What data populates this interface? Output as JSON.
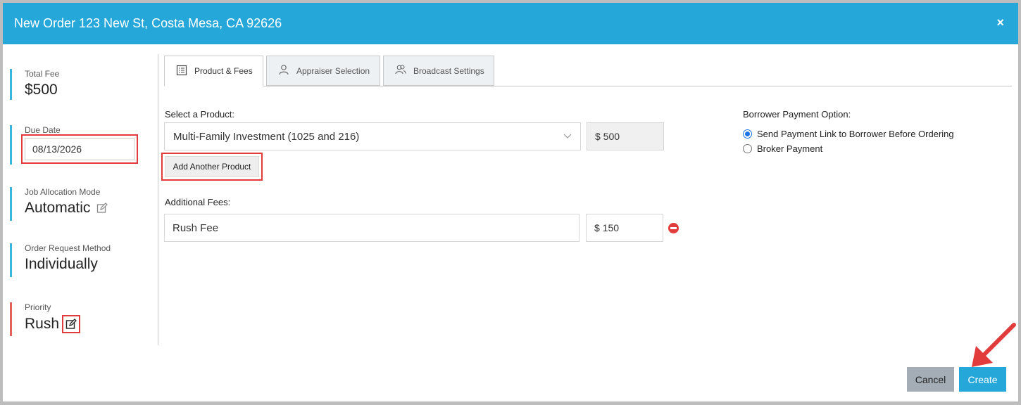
{
  "header": {
    "title": "New Order 123 New St, Costa Mesa, CA 92626",
    "close": "×"
  },
  "sidebar": {
    "total_fee": {
      "label": "Total Fee",
      "value": "$500"
    },
    "due_date": {
      "label": "Due Date",
      "value": "08/13/2026"
    },
    "job_allocation": {
      "label": "Job Allocation Mode",
      "value": "Automatic"
    },
    "order_request": {
      "label": "Order Request Method",
      "value": "Individually"
    },
    "priority": {
      "label": "Priority",
      "value": "Rush"
    }
  },
  "tabs": [
    {
      "label": "Product & Fees",
      "icon": "list-icon",
      "active": true
    },
    {
      "label": "Appraiser Selection",
      "icon": "person-icon",
      "active": false
    },
    {
      "label": "Broadcast Settings",
      "icon": "people-icon",
      "active": false
    }
  ],
  "product": {
    "label": "Select a Product:",
    "selected": "Multi-Family Investment (1025 and 216)",
    "price": "$ 500",
    "add_button": "Add Another Product"
  },
  "fees": {
    "label": "Additional Fees:",
    "name": "Rush Fee",
    "amount": "$ 150"
  },
  "payment": {
    "label": "Borrower Payment Option:",
    "options": [
      {
        "label": "Send Payment Link to Borrower Before Ordering",
        "checked": true
      },
      {
        "label": "Broker Payment",
        "checked": false
      }
    ]
  },
  "footer": {
    "cancel": "Cancel",
    "create": "Create"
  },
  "colors": {
    "header": "#26a7d9",
    "highlight": "#e23b3b",
    "accent_bar": "#3ab6dc",
    "priority_bar": "#e0625a"
  }
}
